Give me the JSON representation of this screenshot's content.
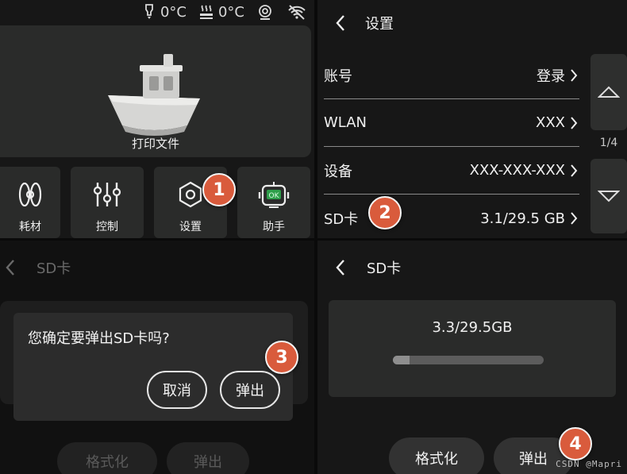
{
  "home": {
    "status": {
      "nozzle_temp": "0°C",
      "bed_temp": "0°C"
    },
    "print_label": "打印文件",
    "tiles": [
      {
        "label": "耗材",
        "icon": "filament-spool-icon"
      },
      {
        "label": "控制",
        "icon": "sliders-icon"
      },
      {
        "label": "设置",
        "icon": "gear-icon"
      },
      {
        "label": "助手",
        "icon": "robot-assistant-icon"
      }
    ]
  },
  "settings": {
    "title": "设置",
    "rows": [
      {
        "label": "账号",
        "value": "登录"
      },
      {
        "label": "WLAN",
        "value": "XXX"
      },
      {
        "label": "设备",
        "value": "XXX-XXX-XXX"
      },
      {
        "label": "SD卡",
        "value": "3.1/29.5 GB"
      }
    ],
    "page_indicator": "1/4"
  },
  "eject_dialog": {
    "title": "SD卡",
    "message": "您确定要弹出SD卡吗?",
    "cancel": "取消",
    "eject": "弹出",
    "bg_format": "格式化",
    "bg_eject": "弹出"
  },
  "sd_card": {
    "title": "SD卡",
    "storage": "3.3/29.5GB",
    "used_fraction": 0.11,
    "format": "格式化",
    "eject": "弹出"
  },
  "badges": [
    "1",
    "2",
    "3",
    "4"
  ],
  "watermark": "CSDN @Mapri"
}
